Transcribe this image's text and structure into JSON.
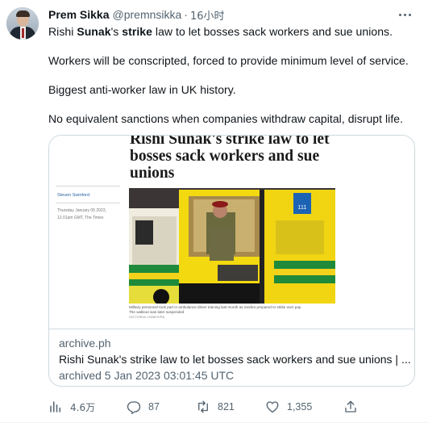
{
  "tweet": {
    "author_name": "Prem Sikka",
    "author_handle": "@premnsikka",
    "separator": "·",
    "time": "16小时",
    "text_lines": [
      [
        "Rishi ",
        "Sunak",
        "'s ",
        "strike",
        " law to let bosses sack workers and sue unions."
      ],
      "Workers will be conscripted, forced to provide minimum level of service.",
      "Biggest anti-worker law in UK history.",
      "No equivalent sanctions when companies withdraw capital, disrupt life."
    ]
  },
  "card": {
    "article": {
      "headline_line1": "Rishi Sunak's strike law to let",
      "headline_line2": "bosses sack workers and sue",
      "headline_line3": "unions",
      "author": "Steven Swinford",
      "date_line1": "Thursday January 05 2023,",
      "date_line2": "12.01am GMT, The Times",
      "caption_line1": "Military personnel took part in ambulance driver training last month as medics prepared to strike over pay.",
      "caption_line2": "The walkout was later suspended",
      "credit": "VICTORIA JONES/PA",
      "ambulance_sign": "111"
    },
    "domain": "archive.ph",
    "title": "Rishi Sunak's strike law to let bosses sack workers and sue unions | ...",
    "description": "archived 5 Jan 2023 03:01:45 UTC"
  },
  "actions": {
    "views": "4.6万",
    "replies": "87",
    "retweets": "821",
    "likes": "1,355"
  },
  "icons": [
    "more-icon",
    "views-icon",
    "reply-icon",
    "retweet-icon",
    "like-icon",
    "share-icon"
  ],
  "colors": {
    "text": "#0f1419",
    "secondary": "#536471",
    "border": "#cfd9de"
  }
}
